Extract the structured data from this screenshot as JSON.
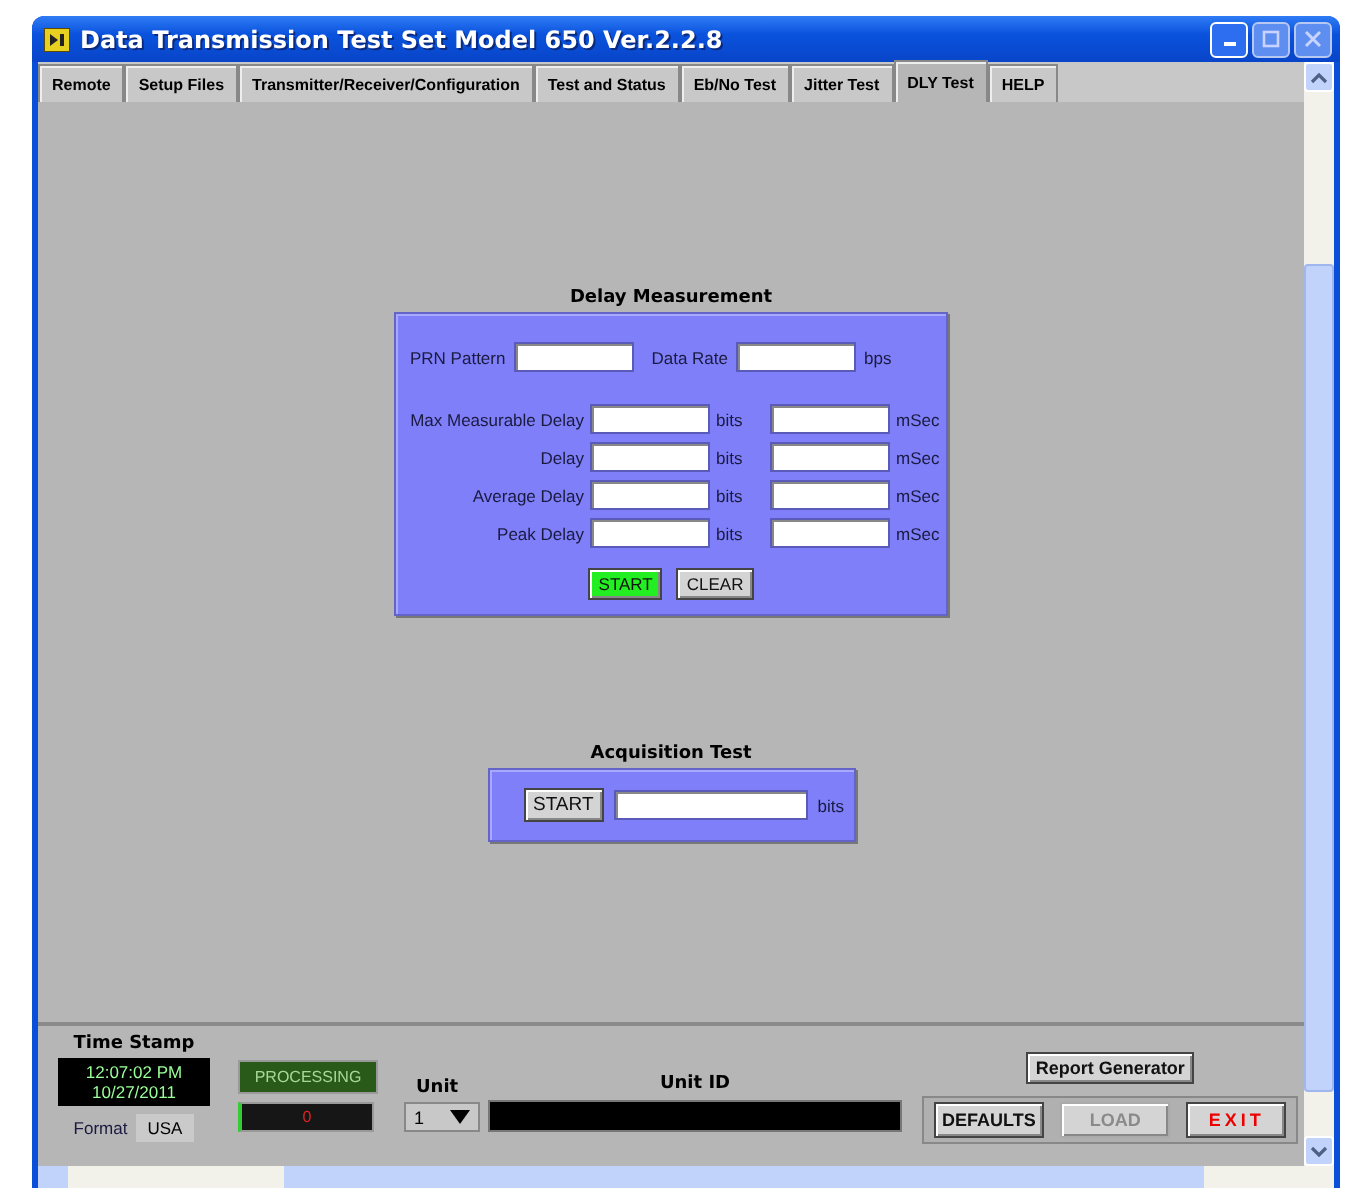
{
  "window": {
    "title": "Data Transmission Test Set Model 650 Ver.2.2.8"
  },
  "tabs": [
    {
      "label": "Remote",
      "selected": false
    },
    {
      "label": "Setup Files",
      "selected": false
    },
    {
      "label": "Transmitter/Receiver/Configuration",
      "selected": false
    },
    {
      "label": "Test and Status",
      "selected": false
    },
    {
      "label": "Eb/No Test",
      "selected": false
    },
    {
      "label": "Jitter Test",
      "selected": false
    },
    {
      "label": "DLY Test",
      "selected": true
    },
    {
      "label": "HELP",
      "selected": false
    }
  ],
  "delay_measurement": {
    "title": "Delay Measurement",
    "prn_label": "PRN Pattern",
    "data_rate_label": "Data Rate",
    "data_rate_unit": "bps",
    "rows": [
      {
        "label": "Max Measurable Delay",
        "unit_1": "bits",
        "unit_2": "mSec"
      },
      {
        "label": "Delay",
        "unit_1": "bits",
        "unit_2": "mSec"
      },
      {
        "label": "Average Delay",
        "unit_1": "bits",
        "unit_2": "mSec"
      },
      {
        "label": "Peak Delay",
        "unit_1": "bits",
        "unit_2": "mSec"
      }
    ],
    "buttons": [
      {
        "label": "START",
        "active": true
      },
      {
        "label": "CLEAR",
        "active": false
      }
    ]
  },
  "acquisition_test": {
    "title": "Acquisition Test",
    "button": "START",
    "unit": "bits"
  },
  "bottom": {
    "time_stamp_title": "Time Stamp",
    "time": "12:07:02 PM",
    "date": "10/27/2011",
    "format_label": "Format",
    "format_value": "USA",
    "processing": {
      "label": "PROCESSING",
      "lit": false
    },
    "counter": "0",
    "unit_label": "Unit",
    "unit_value": "1",
    "unit_id_label": "Unit ID",
    "report_button": "Report Generator",
    "buttons": [
      {
        "label": "DEFAULTS",
        "kind": "normal",
        "disabled": false
      },
      {
        "label": "LOAD",
        "kind": "normal",
        "disabled": true
      },
      {
        "label": "EXIT",
        "kind": "exit",
        "disabled": false
      }
    ]
  }
}
